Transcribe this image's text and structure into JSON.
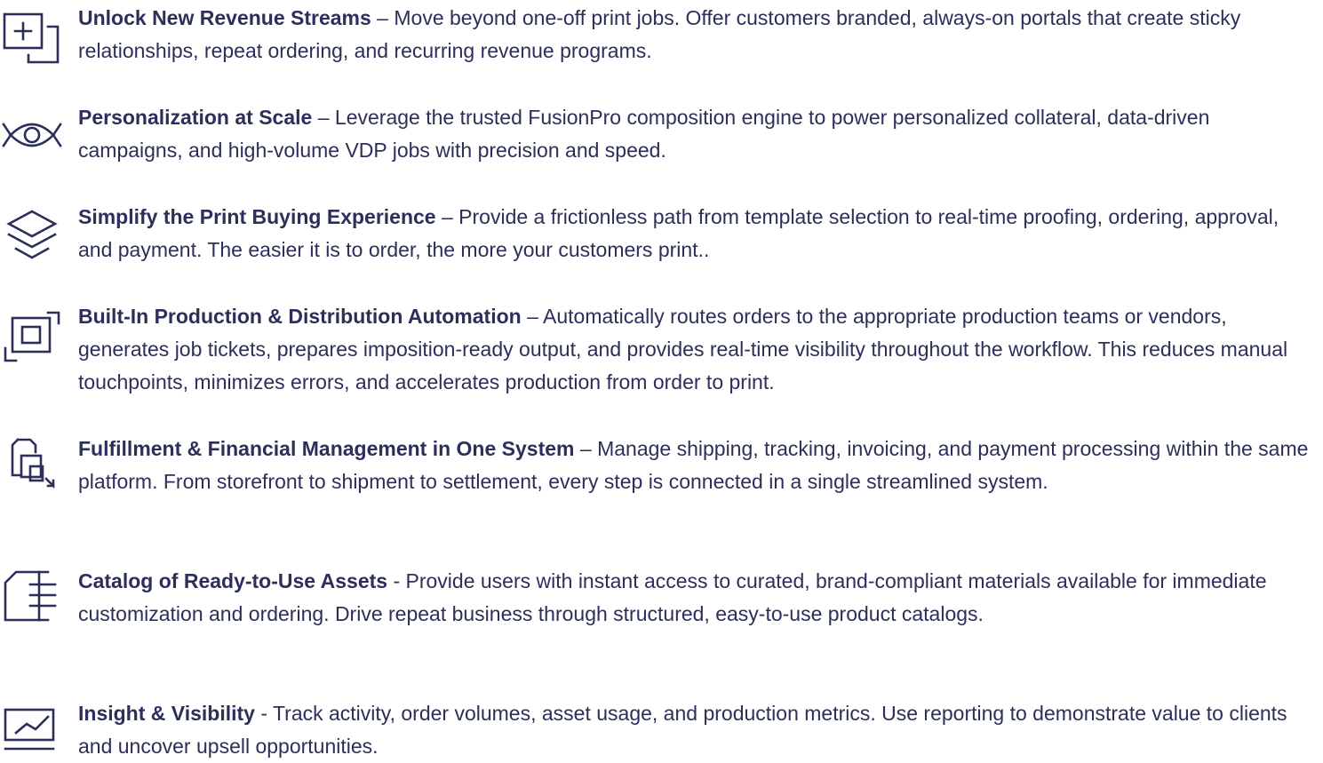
{
  "features": [
    {
      "icon": "add-frame-icon",
      "title": "Unlock New Revenue Streams",
      "separator": " – ",
      "body": "Move beyond one-off print jobs. Offer customers branded, always-on portals that create sticky relationships, repeat ordering, and recurring revenue programs."
    },
    {
      "icon": "eye-icon",
      "title": "Personalization at Scale",
      "separator": " – ",
      "body": "Leverage the trusted FusionPro composition engine to power personalized collateral, data-driven campaigns, and high-volume VDP jobs with precision and speed."
    },
    {
      "icon": "layers-icon",
      "title": "Simplify the Print Buying Experience",
      "separator": " – ",
      "body": "Provide a frictionless path from template selection to real-time proofing, ordering, approval, and payment. The easier it is to order, the more your customers print.."
    },
    {
      "icon": "nested-squares-icon",
      "title": "Built-In Production & Distribution Automation",
      "separator": " – ",
      "body": "Automatically routes orders to the appropriate production teams or vendors, generates job tickets, prepares imposition-ready output, and provides real-time visibility throughout the workflow. This reduces manual touchpoints, minimizes errors, and accelerates production from order to print."
    },
    {
      "icon": "documents-icon",
      "title": "Fulfillment & Financial Management in One System",
      "separator": " – ",
      "body": "Manage shipping, tracking, invoicing, and payment processing within the same platform. From storefront to shipment to settlement, every step is connected in a single streamlined system."
    },
    {
      "icon": "catalog-icon",
      "title": "Catalog of Ready-to-Use Assets",
      "separator": " - ",
      "body": "Provide users with instant access to curated, brand-compliant materials available for immediate customization and ordering. Drive repeat business through structured, easy-to-use product catalogs."
    },
    {
      "icon": "chart-icon",
      "title": "Insight & Visibility",
      "separator": " - ",
      "body": "Track activity, order volumes, asset usage, and production metrics. Use reporting to demonstrate value to clients and uncover upsell opportunities."
    }
  ],
  "colors": {
    "text": "#2b2f5a",
    "background": "#ffffff"
  }
}
